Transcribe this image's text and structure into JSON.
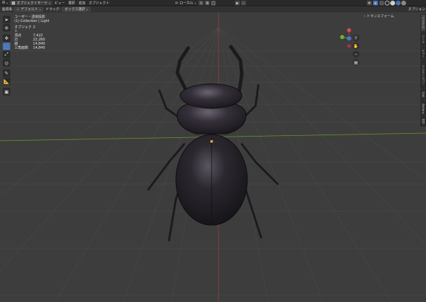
{
  "header": {
    "editor_icon": "⊞",
    "mode_label": "オブジェクトモード",
    "menus": [
      "ビュー",
      "選択",
      "追加",
      "オブジェクト"
    ],
    "orientation_label": "ローカル",
    "right_icons": [
      "cursor-icon",
      "overlay-icon",
      "xray-icon",
      "wire-shading-icon",
      "solid-shading-icon",
      "material-shading-icon",
      "render-shading-icon"
    ]
  },
  "header2": {
    "coord_label": "座標系",
    "coord_value": "デフォルト",
    "drag_label": "ドラッグ:",
    "drag_value": "ボックス選択",
    "options_label": "オプション"
  },
  "overlay": {
    "line1": "ユーザー・透視投影",
    "line2": "(1) Collection | Light",
    "objects_label": "オブジェクト",
    "objects_value": "2",
    "stats": [
      {
        "label": "頂点",
        "value": "7,422"
      },
      {
        "label": "辺",
        "value": "22,260"
      },
      {
        "label": "面",
        "value": "14,840"
      },
      {
        "label": "三角面数",
        "value": "14,840"
      }
    ]
  },
  "toolbar": {
    "tools": [
      {
        "name": "select-tool",
        "glyph": "➤",
        "active": false
      },
      {
        "name": "cursor-tool",
        "glyph": "⊕",
        "active": false
      },
      {
        "name": "move-tool",
        "glyph": "✥",
        "active": false
      },
      {
        "name": "box-select-tool",
        "glyph": "⬚",
        "active": true
      },
      {
        "name": "scale-tool",
        "glyph": "⤢",
        "active": false
      },
      {
        "name": "transform-tool",
        "glyph": "◎",
        "active": false
      },
      {
        "name": "annotate-tool",
        "glyph": "✎",
        "active": false
      },
      {
        "name": "measure-tool",
        "glyph": "📐",
        "active": false
      },
      {
        "name": "add-cube-tool",
        "glyph": "▣",
        "active": false
      }
    ]
  },
  "sidebar": {
    "transform_label": "› トランスフォーム",
    "tabs": [
      "アイテム",
      "ツール",
      "ビュー",
      "アニメーション",
      "Edit",
      "Addons",
      "BSP"
    ]
  },
  "colors": {
    "viewport_bg": "#3d3d3d",
    "x_axis": "#a63c3c",
    "y_axis": "#6a9a2a",
    "accent": "#4772b3"
  }
}
